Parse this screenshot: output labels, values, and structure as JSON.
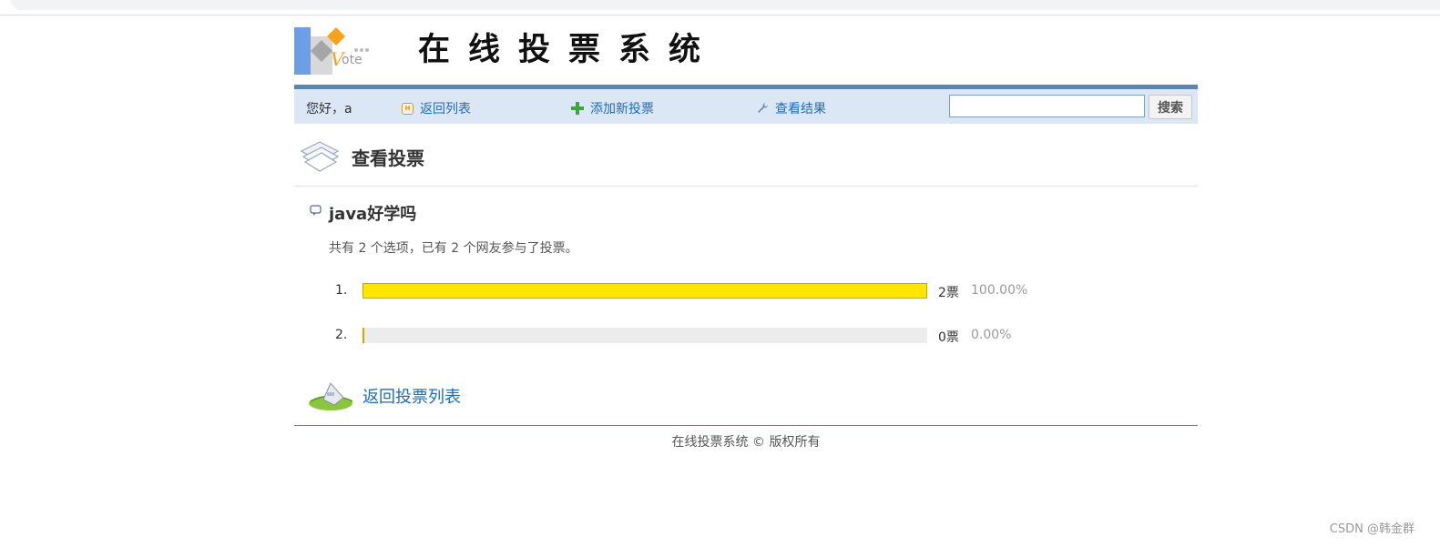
{
  "header": {
    "logo_text": "vote",
    "site_title": "在线投票系统"
  },
  "nav": {
    "greeting": "您好，a",
    "items": [
      {
        "label": "返回列表",
        "icon": "list-icon"
      },
      {
        "label": "添加新投票",
        "icon": "plus-icon"
      },
      {
        "label": "查看结果",
        "icon": "wrench-icon"
      }
    ],
    "search": {
      "value": "",
      "placeholder": "",
      "button_label": "搜索"
    }
  },
  "section": {
    "title": "查看投票"
  },
  "question": {
    "title": "java好学吗",
    "summary": "共有 2 个选项，已有 2 个网友参与了投票。",
    "options": [
      {
        "number": "1.",
        "votes": "2票",
        "percent": "100.00%",
        "fraction": 1.0
      },
      {
        "number": "2.",
        "votes": "0票",
        "percent": "0.00%",
        "fraction": 0.0
      }
    ],
    "back_label": "返回投票列表"
  },
  "footer": {
    "text": "在线投票系统 © 版权所有"
  },
  "watermark": "CSDN @韩金群",
  "colors": {
    "nav_bg": "#dbe7f4",
    "nav_border": "#5a86b1",
    "link": "#1e6cb5",
    "bar_fill": "#ffe600",
    "bar_track": "#ececec"
  }
}
